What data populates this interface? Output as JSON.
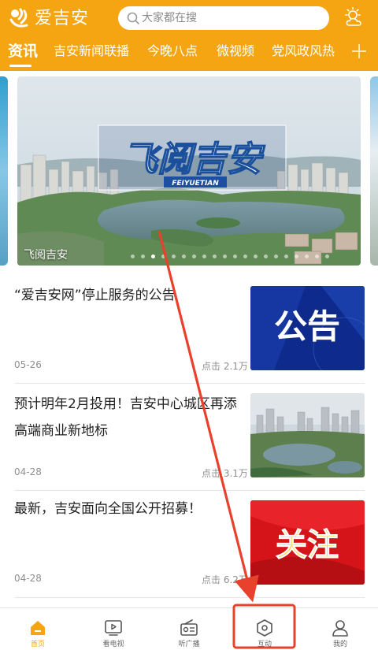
{
  "header": {
    "app_name": "爱吉安",
    "logo_icon": "aijian-logo-icon",
    "weather_icon": "weather-sun-cloud-icon",
    "search": {
      "placeholder": "大家都在搜",
      "value": ""
    },
    "accent": "#f5a512"
  },
  "tabs": [
    {
      "label": "资讯",
      "active": true
    },
    {
      "label": "吉安新闻联播",
      "active": false
    },
    {
      "label": "今晚八点",
      "active": false
    },
    {
      "label": "微视频",
      "active": false
    },
    {
      "label": "党风政风热",
      "active": false
    }
  ],
  "add_tab_icon": "plus-icon",
  "banner": {
    "caption": "飞阅吉安",
    "overlay_title": "飞阅吉安",
    "overlay_subtitle": "FEIYUETIAN",
    "dot_count": 20,
    "active_dot": 2
  },
  "news": [
    {
      "title": "“爱吉安网”停止服务的公告",
      "date": "05-26",
      "views": "点击 2.1万",
      "thumb_text": "公告"
    },
    {
      "title": "预计明年2月投用！吉安中心城区再添高端商业新地标",
      "date": "04-28",
      "views": "点击 3.1万",
      "thumb_text": ""
    },
    {
      "title": "最新，吉安面向全国公开招募！",
      "date": "04-28",
      "views": "点击 6.2万",
      "thumb_text": "关注"
    }
  ],
  "bottom_nav": [
    {
      "label": "首页",
      "icon": "home-icon",
      "active": true
    },
    {
      "label": "看电视",
      "icon": "tv-icon",
      "active": false
    },
    {
      "label": "听广播",
      "icon": "radio-icon",
      "active": false
    },
    {
      "label": "互动",
      "icon": "hexagon-icon",
      "active": false
    },
    {
      "label": "我的",
      "icon": "user-icon",
      "active": false
    }
  ],
  "annotation_color": "#e8412c"
}
